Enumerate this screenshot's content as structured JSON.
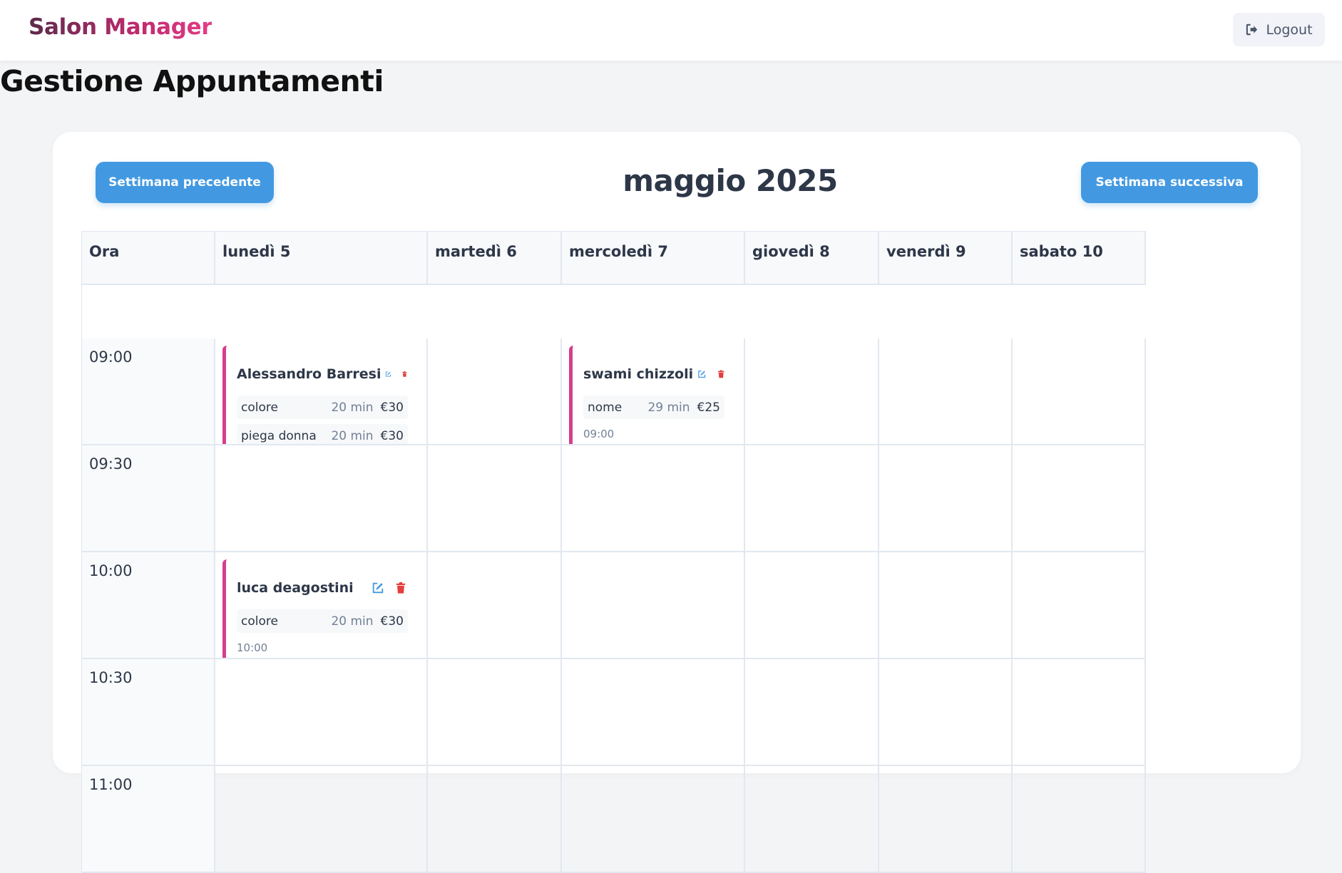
{
  "navbar": {
    "brand": "Salon Manager",
    "logout_label": "Logout"
  },
  "page_title": "Gestione Appuntamenti",
  "calendar": {
    "prev_week": "Settimana precedente",
    "next_week": "Settimana successiva",
    "month_label": "maggio 2025",
    "headers": [
      "Ora",
      "lunedì 5",
      "martedì 6",
      "mercoledì 7",
      "giovedì 8",
      "venerdì 9",
      "sabato 10"
    ],
    "times": [
      "09:00",
      "09:30",
      "10:00",
      "10:30",
      "11:00"
    ],
    "appointments": [
      {
        "day": "lunedì 5",
        "time": "09:00",
        "client": "Alessandro Barresi",
        "services": [
          {
            "name": "colore",
            "duration": "20 min",
            "price": "€30"
          },
          {
            "name": "piega donna",
            "duration": "20 min",
            "price": "€30"
          }
        ]
      },
      {
        "day": "mercoledì 7",
        "time": "09:00",
        "client": "swami chizzoli",
        "services": [
          {
            "name": "nome",
            "duration": "29 min",
            "price": "€25"
          }
        ],
        "time_label": "09:00"
      },
      {
        "day": "lunedì 5",
        "time": "10:00",
        "client": "luca deagostini",
        "services": [
          {
            "name": "colore",
            "duration": "20 min",
            "price": "€30"
          }
        ],
        "time_label": "10:00"
      }
    ]
  },
  "colors": {
    "accent": "#4299e1",
    "appointment_border": "#d53f8c",
    "delete": "#e53e3e"
  }
}
